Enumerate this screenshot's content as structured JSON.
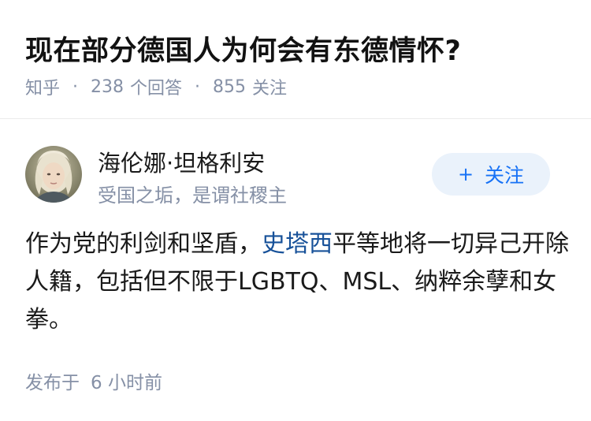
{
  "question": {
    "title": "现在部分德国人为何会有东德情怀?",
    "source": "知乎",
    "answer_count": "238",
    "answer_label": "个回答",
    "follower_count": "855",
    "follower_label": "关注"
  },
  "author": {
    "name": "海伦娜·坦格利安",
    "bio": "受国之垢，是谓社稷主"
  },
  "follow_button": {
    "icon": "+",
    "label": "关注"
  },
  "answer": {
    "text_before_link": "作为党的利剑和坚盾，",
    "link_text": "史塔西",
    "text_after_link": "平等地将一切异己开除人籍，包括但不限于LGBTQ、MSL、纳粹余孽和女拳。"
  },
  "post_time": {
    "label": "发布于",
    "value": "6 小时前"
  },
  "colors": {
    "meta_gray": "#8590a6",
    "link_blue": "#175199",
    "follow_bg": "#eaf2fb",
    "follow_text": "#1772f6"
  }
}
